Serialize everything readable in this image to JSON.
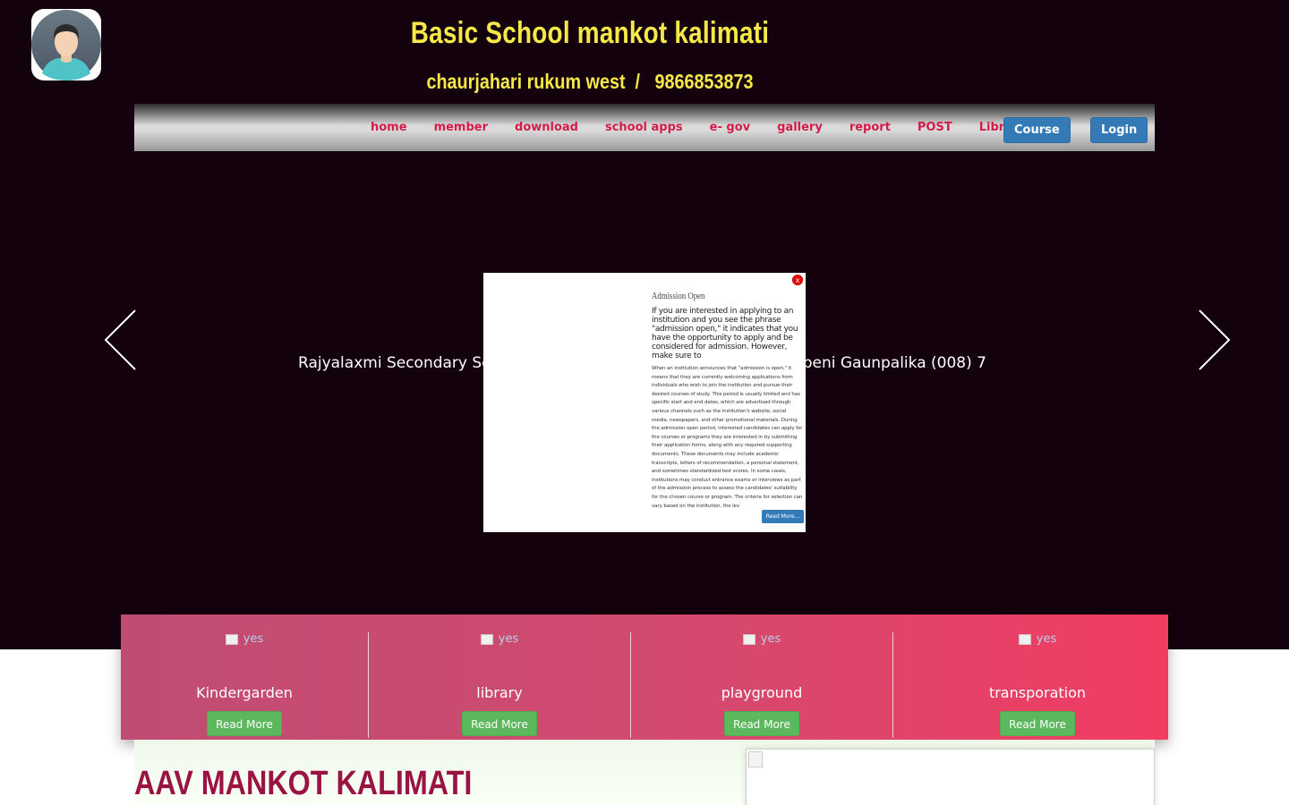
{
  "header": {
    "title": "Basic School mankot kalimati",
    "subtitle": "chaurjahari rukum west  /   9866853873"
  },
  "nav": {
    "links": [
      "home",
      "member",
      "download",
      "school apps",
      "e- gov",
      "gallery",
      "report",
      "POST",
      "Library"
    ],
    "course_button": "Course",
    "login_button": "Login"
  },
  "slider": {
    "text_left": "Rajyalaxmi Secondary Sc",
    "text_right": "ribeni Gaunpalika (008) 7"
  },
  "modal": {
    "title": "Admission Open",
    "close": "x",
    "lead": "If you are interested in applying to an institution and you see the phrase \"admission open,\" it indicates that you have the opportunity to apply and be considered for admission. However, make sure to",
    "body": "When an institution announces that \"admission is open,\" it means that they are currently welcoming applications from individuals who wish to join the institution and pursue their desired courses of study. This period is usually limited and has specific start and end dates, which are advertised through various channels such as the institution's website, social media, newspapers, and other promotional materials. During the admission open period, interested candidates can apply for the courses or programs they are interested in by submitting their application forms, along with any required supporting documents. These documents may include academic transcripts, letters of recommendation, a personal statement, and sometimes standardized test scores. In some cases, institutions may conduct entrance exams or interviews as part of the admission process to assess the candidates' suitability for the chosen course or program. The criteria for selection can vary based on the institution, the lev",
    "read_more": "Read More..."
  },
  "features": [
    {
      "img_alt": "yes",
      "title": "Kindergarden",
      "button": "Read More"
    },
    {
      "img_alt": "yes",
      "title": "library",
      "button": "Read More"
    },
    {
      "img_alt": "yes",
      "title": "playground",
      "button": "Read More"
    },
    {
      "img_alt": "yes",
      "title": "transporation",
      "button": "Read More"
    }
  ],
  "about": {
    "title": "AAV MANKOT KALIMATI"
  },
  "colors": {
    "hero_bg": "#13020d",
    "title": "#f7e84a",
    "nav_link": "#d31c4b",
    "button_blue": "#337ab7",
    "button_green": "#5cb85c",
    "about_title": "#9a1342"
  },
  "icons": [
    "user-avatar-icon",
    "arrow-left-icon",
    "arrow-right-icon",
    "close-icon",
    "broken-image-icon"
  ]
}
